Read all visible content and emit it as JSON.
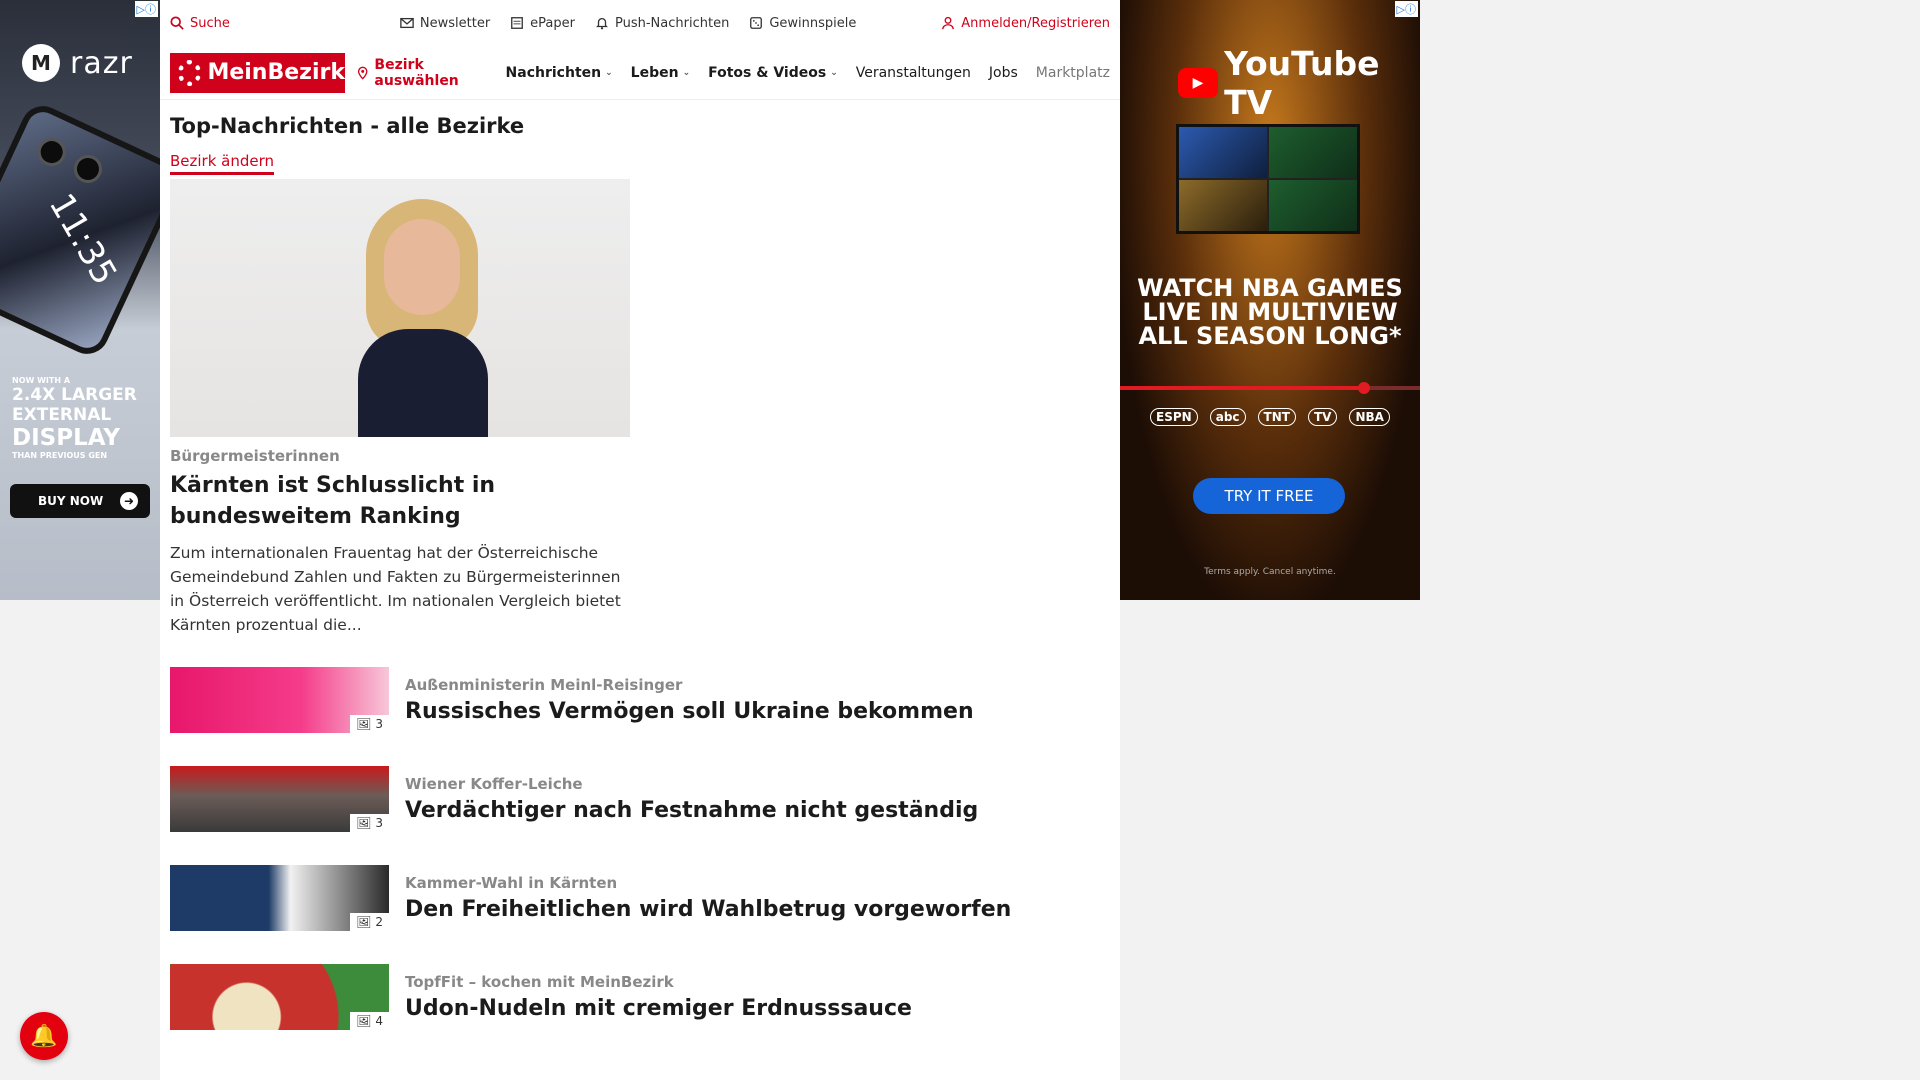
{
  "left_ad": {
    "badge": "▷ⓘ",
    "brand": "razr",
    "phone_time": "11:35",
    "tag_small": "NOW WITH A",
    "tag_line1": "2.4X LARGER",
    "tag_line2": "EXTERNAL",
    "tag_line3": "DISPLAY",
    "tag_small2": "THAN PREVIOUS GEN",
    "cta": "BUY NOW"
  },
  "topbar": {
    "search": "Suche",
    "newsletter": "Newsletter",
    "epaper": "ePaper",
    "push": "Push-Nachrichten",
    "gewinnspiele": "Gewinnspiele",
    "login": "Anmelden/Registrieren"
  },
  "navbar": {
    "logo": "MeinBezirk",
    "bezirk": "Bezirk auswählen",
    "items": [
      "Nachrichten",
      "Leben",
      "Fotos & Videos",
      "Veranstaltungen",
      "Jobs",
      "Marktplatz"
    ]
  },
  "main": {
    "page_title": "Top-Nachrichten - alle Bezirke",
    "change_link": "Bezirk ändern",
    "hero": {
      "kicker": "Bürgermeisterinnen",
      "title": "Kärnten ist Schlusslicht in bundesweitem Ranking",
      "teaser": "Zum internationalen Frauentag hat der Österreichische Gemeindebund Zahlen und Fakten zu Bürgermeisterinnen in Österreich veröffentlicht. Im nationalen Vergleich bietet Kärnten prozentual die..."
    },
    "articles": [
      {
        "kicker": "Außenministerin Meinl-Reisinger",
        "title": "Russisches Vermögen soll Ukraine bekommen",
        "count": "3"
      },
      {
        "kicker": "Wiener Koffer-Leiche",
        "title": "Verdächtiger nach Festnahme nicht geständig",
        "count": "3"
      },
      {
        "kicker": "Kammer-Wahl in Kärnten",
        "title": "Den Freiheitlichen wird Wahlbetrug vorgeworfen",
        "count": "2"
      },
      {
        "kicker": "TopfFit – kochen mit MeinBezirk",
        "title": "Udon-Nudeln mit cremiger Erdnusssauce",
        "count": "4"
      }
    ]
  },
  "right_ad": {
    "badge": "▷ⓘ",
    "brand": "YouTube TV",
    "headline": "WATCH NBA GAMES LIVE IN MULTIVIEW ALL SEASON LONG*",
    "logos": [
      "ESPN",
      "abc",
      "TNT",
      "TV",
      "NBA"
    ],
    "cta": "TRY IT FREE",
    "terms": "Terms apply. Cancel anytime."
  },
  "colors": {
    "brand_red": "#d0021b",
    "kicker_grey": "#888888",
    "cta_blue": "#1565d8"
  }
}
